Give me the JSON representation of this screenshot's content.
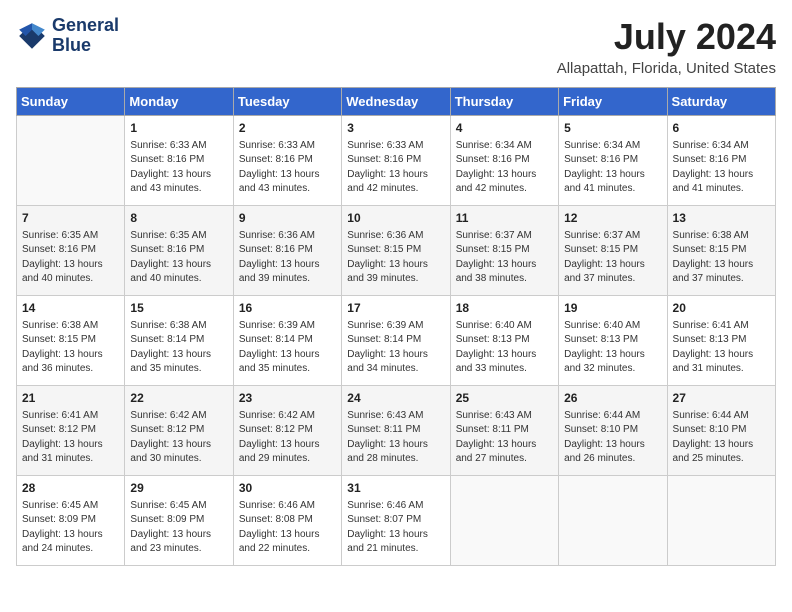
{
  "header": {
    "logo_line1": "General",
    "logo_line2": "Blue",
    "title": "July 2024",
    "subtitle": "Allapattah, Florida, United States"
  },
  "calendar": {
    "days_of_week": [
      "Sunday",
      "Monday",
      "Tuesday",
      "Wednesday",
      "Thursday",
      "Friday",
      "Saturday"
    ],
    "weeks": [
      [
        {
          "day": "",
          "info": ""
        },
        {
          "day": "1",
          "info": "Sunrise: 6:33 AM\nSunset: 8:16 PM\nDaylight: 13 hours\nand 43 minutes."
        },
        {
          "day": "2",
          "info": "Sunrise: 6:33 AM\nSunset: 8:16 PM\nDaylight: 13 hours\nand 43 minutes."
        },
        {
          "day": "3",
          "info": "Sunrise: 6:33 AM\nSunset: 8:16 PM\nDaylight: 13 hours\nand 42 minutes."
        },
        {
          "day": "4",
          "info": "Sunrise: 6:34 AM\nSunset: 8:16 PM\nDaylight: 13 hours\nand 42 minutes."
        },
        {
          "day": "5",
          "info": "Sunrise: 6:34 AM\nSunset: 8:16 PM\nDaylight: 13 hours\nand 41 minutes."
        },
        {
          "day": "6",
          "info": "Sunrise: 6:34 AM\nSunset: 8:16 PM\nDaylight: 13 hours\nand 41 minutes."
        }
      ],
      [
        {
          "day": "7",
          "info": "Sunrise: 6:35 AM\nSunset: 8:16 PM\nDaylight: 13 hours\nand 40 minutes."
        },
        {
          "day": "8",
          "info": "Sunrise: 6:35 AM\nSunset: 8:16 PM\nDaylight: 13 hours\nand 40 minutes."
        },
        {
          "day": "9",
          "info": "Sunrise: 6:36 AM\nSunset: 8:16 PM\nDaylight: 13 hours\nand 39 minutes."
        },
        {
          "day": "10",
          "info": "Sunrise: 6:36 AM\nSunset: 8:15 PM\nDaylight: 13 hours\nand 39 minutes."
        },
        {
          "day": "11",
          "info": "Sunrise: 6:37 AM\nSunset: 8:15 PM\nDaylight: 13 hours\nand 38 minutes."
        },
        {
          "day": "12",
          "info": "Sunrise: 6:37 AM\nSunset: 8:15 PM\nDaylight: 13 hours\nand 37 minutes."
        },
        {
          "day": "13",
          "info": "Sunrise: 6:38 AM\nSunset: 8:15 PM\nDaylight: 13 hours\nand 37 minutes."
        }
      ],
      [
        {
          "day": "14",
          "info": "Sunrise: 6:38 AM\nSunset: 8:15 PM\nDaylight: 13 hours\nand 36 minutes."
        },
        {
          "day": "15",
          "info": "Sunrise: 6:38 AM\nSunset: 8:14 PM\nDaylight: 13 hours\nand 35 minutes."
        },
        {
          "day": "16",
          "info": "Sunrise: 6:39 AM\nSunset: 8:14 PM\nDaylight: 13 hours\nand 35 minutes."
        },
        {
          "day": "17",
          "info": "Sunrise: 6:39 AM\nSunset: 8:14 PM\nDaylight: 13 hours\nand 34 minutes."
        },
        {
          "day": "18",
          "info": "Sunrise: 6:40 AM\nSunset: 8:13 PM\nDaylight: 13 hours\nand 33 minutes."
        },
        {
          "day": "19",
          "info": "Sunrise: 6:40 AM\nSunset: 8:13 PM\nDaylight: 13 hours\nand 32 minutes."
        },
        {
          "day": "20",
          "info": "Sunrise: 6:41 AM\nSunset: 8:13 PM\nDaylight: 13 hours\nand 31 minutes."
        }
      ],
      [
        {
          "day": "21",
          "info": "Sunrise: 6:41 AM\nSunset: 8:12 PM\nDaylight: 13 hours\nand 31 minutes."
        },
        {
          "day": "22",
          "info": "Sunrise: 6:42 AM\nSunset: 8:12 PM\nDaylight: 13 hours\nand 30 minutes."
        },
        {
          "day": "23",
          "info": "Sunrise: 6:42 AM\nSunset: 8:12 PM\nDaylight: 13 hours\nand 29 minutes."
        },
        {
          "day": "24",
          "info": "Sunrise: 6:43 AM\nSunset: 8:11 PM\nDaylight: 13 hours\nand 28 minutes."
        },
        {
          "day": "25",
          "info": "Sunrise: 6:43 AM\nSunset: 8:11 PM\nDaylight: 13 hours\nand 27 minutes."
        },
        {
          "day": "26",
          "info": "Sunrise: 6:44 AM\nSunset: 8:10 PM\nDaylight: 13 hours\nand 26 minutes."
        },
        {
          "day": "27",
          "info": "Sunrise: 6:44 AM\nSunset: 8:10 PM\nDaylight: 13 hours\nand 25 minutes."
        }
      ],
      [
        {
          "day": "28",
          "info": "Sunrise: 6:45 AM\nSunset: 8:09 PM\nDaylight: 13 hours\nand 24 minutes."
        },
        {
          "day": "29",
          "info": "Sunrise: 6:45 AM\nSunset: 8:09 PM\nDaylight: 13 hours\nand 23 minutes."
        },
        {
          "day": "30",
          "info": "Sunrise: 6:46 AM\nSunset: 8:08 PM\nDaylight: 13 hours\nand 22 minutes."
        },
        {
          "day": "31",
          "info": "Sunrise: 6:46 AM\nSunset: 8:07 PM\nDaylight: 13 hours\nand 21 minutes."
        },
        {
          "day": "",
          "info": ""
        },
        {
          "day": "",
          "info": ""
        },
        {
          "day": "",
          "info": ""
        }
      ]
    ]
  }
}
